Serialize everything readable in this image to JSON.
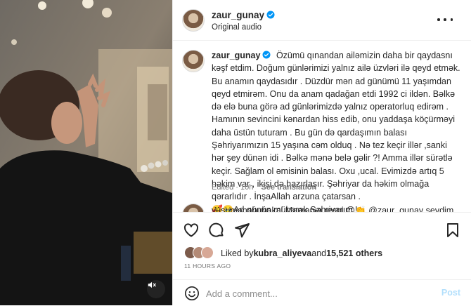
{
  "header": {
    "username": "zaur_gunay",
    "audio": "Original audio"
  },
  "caption": {
    "username": "zaur_gunay",
    "text": "Özümü qınandan ailəmizin daha bir qaydasnı kəşf etdim. Doğum günlərimizi yalnız ailə üzvləri ilə qeyd etmək. Bu anamın qaydasıdır . Düzdür mən ad günümü 11 yaşımdan qeyd etmirəm. Onu da anam qadağan etdi 1992 ci ildən. Bəlkə də elə buna görə ad günlərimizdə yalnız operatorluq edirəm . Hamının sevincini kənardan hiss edib, onu yaddaşa köçürməyi daha üstün tuturam . Bu gün də qardaşımın balası Şəhriyarımızın 15 yaşına cəm olduq . Nə tez keçir illər ,sanki hər şey dünən idi . Bəlkə mənə belə gəlir ?! Amma illər sürətlə keçir. Sağlam ol əmisinin balası. Oxu ,ucal. Evimizdə artıq 5 həkim var , ikisi də hazırlaşır. Şəhriyar da həkim olmağa qərarlıdır . İnşaAllah arzuna çatarsan .",
    "last_line": "🥰🥹Ad günün mübarək Şəhriyarım !",
    "edited": "Edited · 10h",
    "see_translation": "See translation"
  },
  "next_comment": {
    "text": "yusumanabubakal Mamanın respi 😍👏 @zaur_gunay sevdim"
  },
  "icons": {
    "like": "heart-icon",
    "comment": "comment-icon",
    "share": "send-icon",
    "save": "bookmark-icon",
    "emoji": "smiley-icon",
    "audio": "mute-icon"
  },
  "likes": {
    "prefix": "Liked by ",
    "user": "kubra_aliyeva",
    "middle": " and ",
    "count": "15,521 others"
  },
  "timestamp": "11 HOURS AGO",
  "add_comment": {
    "placeholder": "Add a comment...",
    "post_label": "Post"
  },
  "colors": {
    "verified": "#0095f6",
    "post_button": "#b2dffc",
    "muted_text": "#737373"
  }
}
